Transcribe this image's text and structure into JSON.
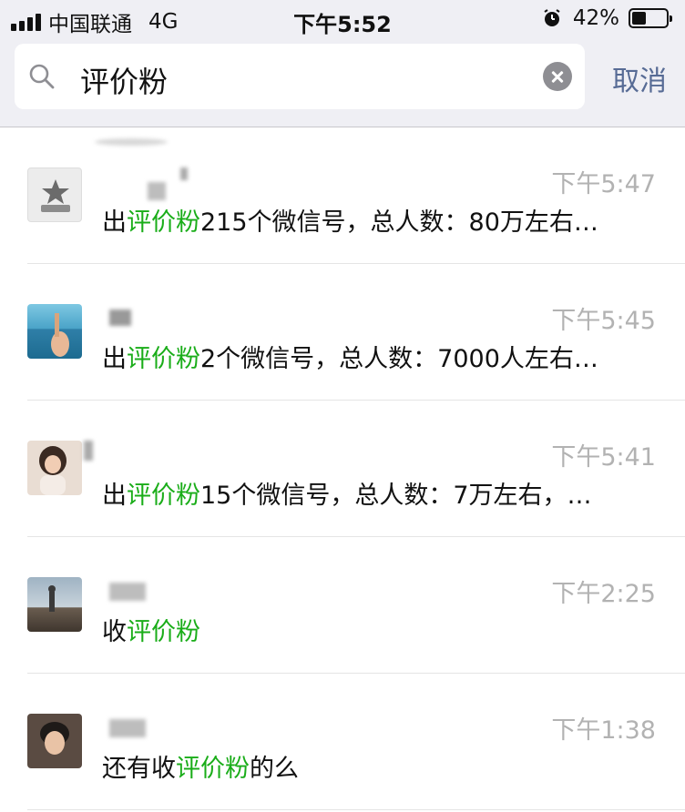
{
  "status_bar": {
    "carrier": "中国联通",
    "network": "4G",
    "time": "下午5:52",
    "battery": "42%",
    "battery_level": 0.42
  },
  "search": {
    "query": "评价粉",
    "cancel_label": "取消"
  },
  "colors": {
    "highlight": "#1aad19",
    "link_blue": "#576b95",
    "timestamp_gray": "#b2b2b2"
  },
  "results": [
    {
      "time": "下午5:47",
      "msg_pre": "出",
      "msg_hl": "评价粉",
      "msg_post": "215个微信号，总人数：80万左右…"
    },
    {
      "time": "下午5:45",
      "msg_pre": "出",
      "msg_hl": "评价粉",
      "msg_post": "2个微信号，总人数：7000人左右…"
    },
    {
      "time": "下午5:41",
      "msg_pre": "出",
      "msg_hl": "评价粉",
      "msg_post": "15个微信号，总人数：7万左右，…"
    },
    {
      "time": "下午2:25",
      "msg_pre": "收",
      "msg_hl": "评价粉",
      "msg_post": ""
    },
    {
      "time": "下午1:38",
      "msg_pre": "还有收",
      "msg_hl": "评价粉",
      "msg_post": "的么"
    }
  ]
}
